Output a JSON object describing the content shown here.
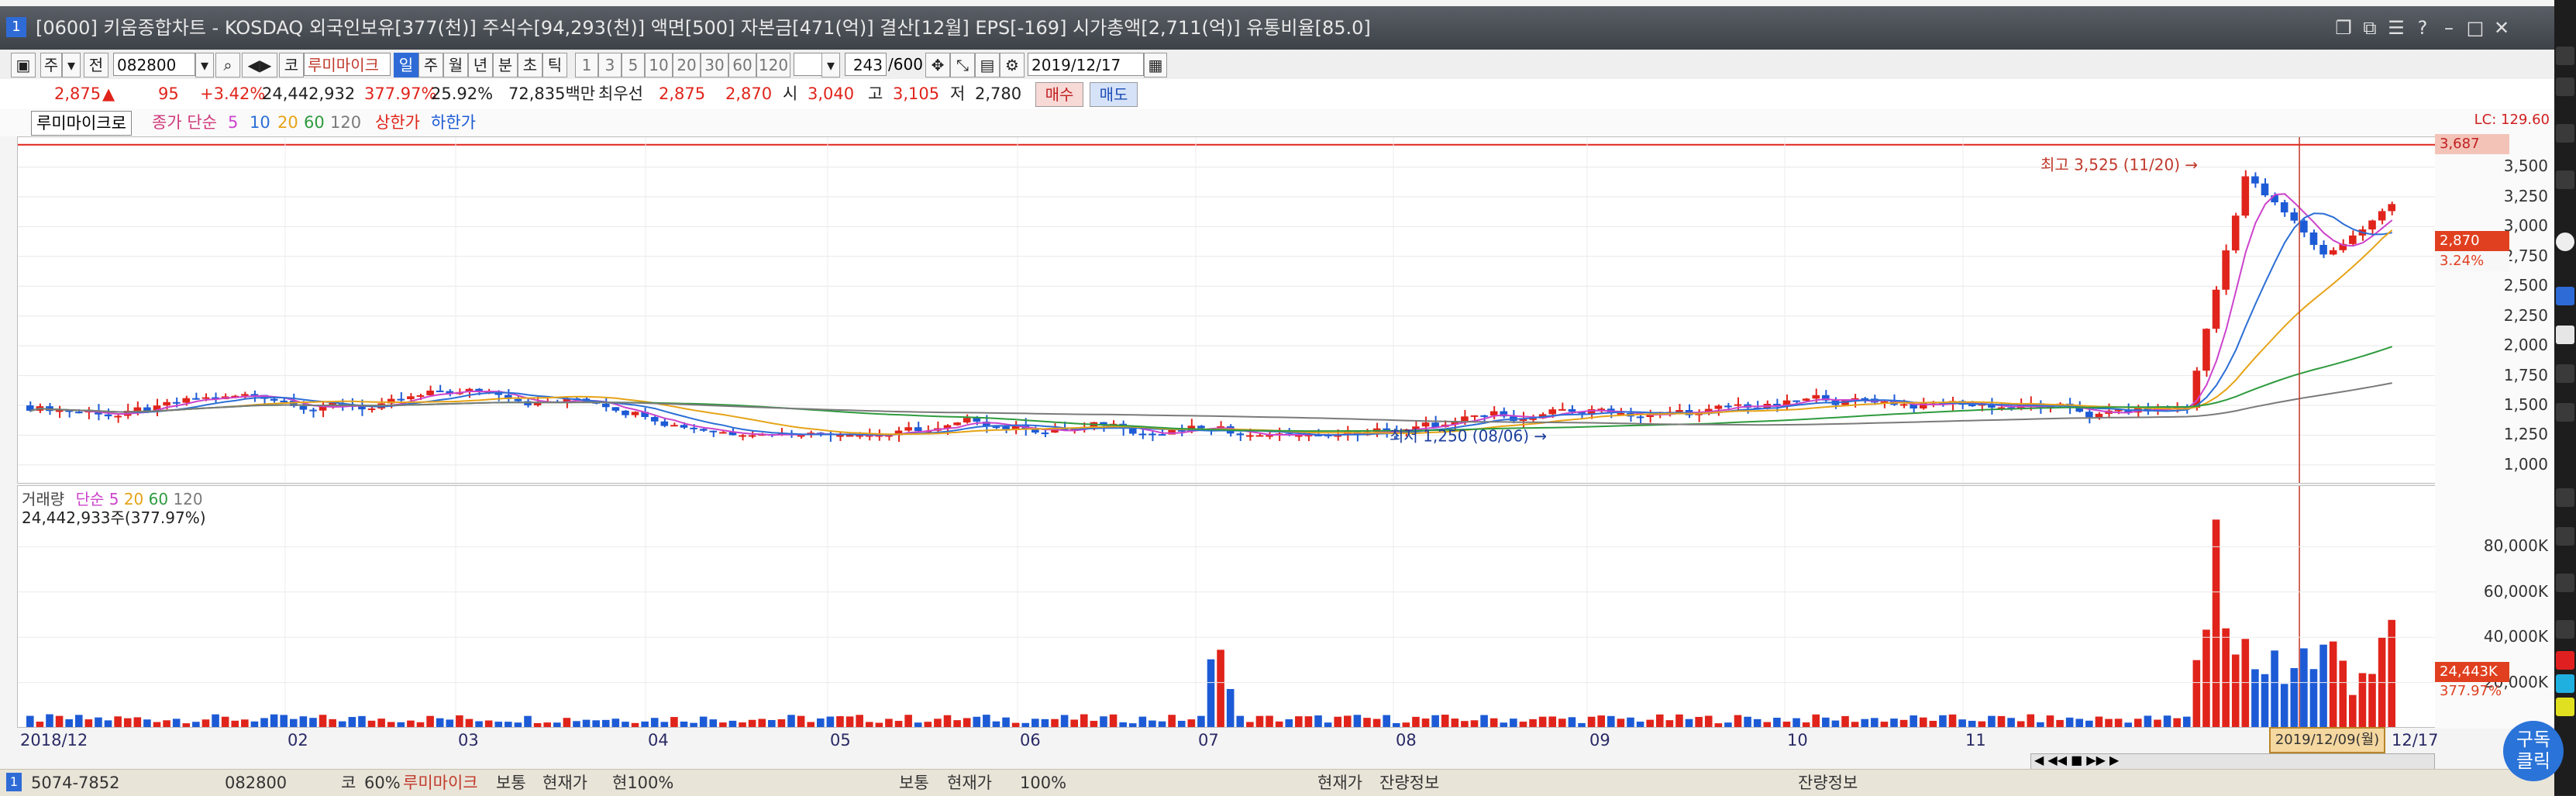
{
  "window": {
    "title": "[0600] 키움종합차트 - KOSDAQ 외국인보유[377(천)] 주식수[94,293(천)] 액면[500] 자본금[471(억)] 결산[12월] EPS[-169] 시가총액[2,711(억)] 유통비율[85.0]",
    "tab_icon": "1"
  },
  "toolbar": {
    "market": "주",
    "period_mode": "전",
    "code": "082800",
    "kind": "코",
    "name": "루미마이크",
    "periods": [
      "일",
      "주",
      "월",
      "년",
      "분",
      "초",
      "틱"
    ],
    "selected_period": "일",
    "minute_options": [
      "1",
      "3",
      "5",
      "10",
      "20",
      "30",
      "60",
      "120"
    ],
    "count": "243",
    "count_max": "/600",
    "date": "2019/12/17"
  },
  "quote": {
    "price": "2,875",
    "change": "95",
    "change_pct": "+3.42%",
    "volume": "24,442,932",
    "volume_pct": "377.97%",
    "turnover": "25.92%",
    "amount": "72,835백만",
    "best_ask_label": "최우선",
    "best_ask": "2,875",
    "best_bid": "2,870",
    "open_label": "시",
    "open": "3,040",
    "high_label": "고",
    "high": "3,105",
    "low_label": "저",
    "low": "2,780",
    "buy_label": "매수",
    "sell_label": "매도"
  },
  "legend": {
    "name": "루미마이크로",
    "ma_label": "종가 단순",
    "ma": [
      "5",
      "10",
      "20",
      "60",
      "120"
    ],
    "upper": "상한가",
    "lower": "하한가",
    "vol_name": "거래량",
    "vol_ma_label": "단순",
    "vol_ma": [
      "5",
      "20",
      "60",
      "120"
    ],
    "vol_value": "24,442,933주(377.97%)"
  },
  "colors": {
    "up": "#e0241b",
    "down": "#1d5bd6",
    "ma5": "#cc44cc",
    "ma10": "#2c6fd6",
    "ma20": "#e6a317",
    "ma60": "#2e9b3e",
    "ma120": "#7a7a7a"
  },
  "price_axis": {
    "labels": [
      "3,500",
      "3,250",
      "3,000",
      "2,750",
      "2,500",
      "2,250",
      "2,000",
      "1,750",
      "1,500",
      "1,250",
      "1,000"
    ],
    "upper_limit": "LC: 129.60",
    "upper_price": "3,687",
    "current_price": "2,870",
    "current_pct": "3.24%"
  },
  "vol_axis": {
    "labels": [
      "80,000K",
      "60,000K",
      "40,000K",
      "20,000K"
    ],
    "current": "24,443K",
    "pct": "377.97%"
  },
  "annotations": {
    "high": "최고 3,525 (11/20)",
    "low": "최저 1,250 (08/06)"
  },
  "x_labels": [
    "2018/12",
    "02",
    "03",
    "04",
    "05",
    "06",
    "07",
    "08",
    "09",
    "10",
    "11",
    "12/17"
  ],
  "cursor_date": "2019/12/09(월)",
  "status": {
    "left_code": "5074-7852",
    "code": "082800",
    "kind": "코",
    "pct": "60%",
    "name": "루미마이크",
    "t1": "보통",
    "t2": "현재가",
    "t3": "현100%",
    "t4": "보통",
    "t5": "현재가",
    "t6": "100%",
    "t7": "현재가",
    "t8": "잔량정보",
    "t9": "잔량정보"
  },
  "badge": "구독\n클릭"
}
